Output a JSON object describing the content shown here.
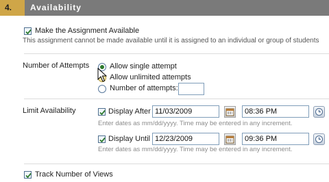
{
  "section": {
    "number": "4.",
    "title": "Availability"
  },
  "make_available": {
    "label": "Make the Assignment Available",
    "checked": true,
    "note": "This assignment cannot be made available until it is assigned to an individual or group of students"
  },
  "attempts": {
    "label": "Number of Attempts",
    "options": [
      {
        "label": "Allow single attempt",
        "selected": true
      },
      {
        "label": "Allow unlimited attempts",
        "selected": false
      },
      {
        "label": "Number of attempts:",
        "selected": false
      }
    ],
    "count_value": ""
  },
  "limit": {
    "label": "Limit Availability",
    "display_after": {
      "label": "Display After",
      "checked": true,
      "date": "11/03/2009",
      "time": "08:36 PM"
    },
    "display_until": {
      "label": "Display Until",
      "checked": true,
      "date": "12/23/2009",
      "time": "09:36 PM"
    },
    "hint": "Enter dates as mm/dd/yyyy. Time may be entered in any increment."
  },
  "track_views": {
    "label": "Track Number of Views",
    "checked": true
  },
  "colors": {
    "header_bg": "#7a7a7a",
    "step_bg": "#cfa648",
    "check_color": "#2d7a2d"
  },
  "icons": {
    "calendar": "calendar-icon",
    "clock": "clock-icon",
    "cursor": "mouse-pointer-icon"
  }
}
